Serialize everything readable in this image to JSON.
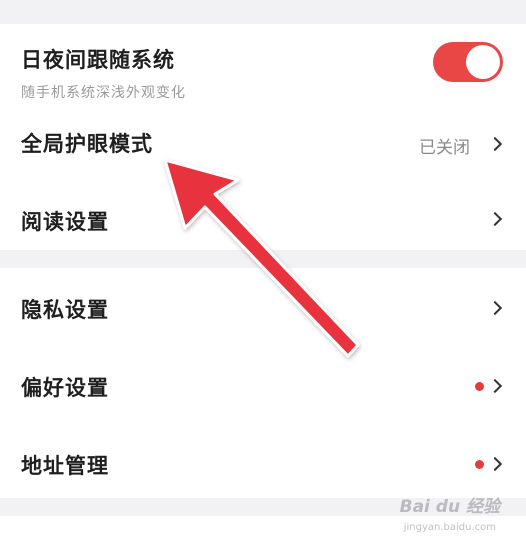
{
  "settings": {
    "day_night": {
      "label": "日夜间跟随系统",
      "subtitle": "随手机系统深浅外观变化",
      "enabled": true
    },
    "eye_care": {
      "label": "全局护眼模式",
      "status": "已关闭"
    },
    "reading": {
      "label": "阅读设置"
    },
    "privacy": {
      "label": "隐私设置"
    },
    "preference": {
      "label": "偏好设置",
      "badge": true
    },
    "address": {
      "label": "地址管理",
      "badge": true
    }
  },
  "colors": {
    "accent": "#e94646",
    "badge": "#e53b3b",
    "annotation_arrow": "#e8323c"
  },
  "icons": {
    "chevron": "chevron-right-icon",
    "badge": "red-dot-icon",
    "annotation": "red-arrow-annotation"
  },
  "watermark": {
    "brand": "Bai du 经验",
    "url": "jingyan.baidu.com"
  }
}
